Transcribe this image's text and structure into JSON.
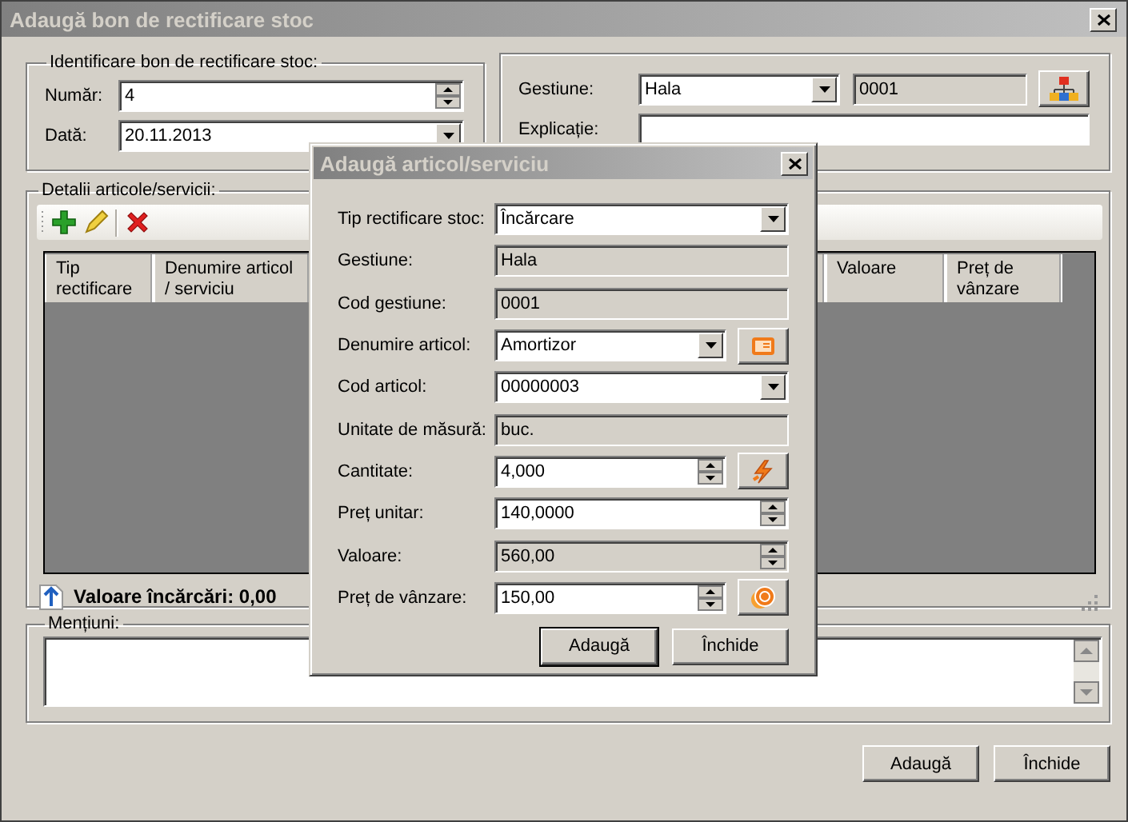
{
  "window": {
    "title": "Adaugă bon de rectificare stoc"
  },
  "identification": {
    "legend": "Identificare bon de rectificare stoc:",
    "fields": [
      {
        "label": "Număr:",
        "value": "4",
        "kind": "spin"
      },
      {
        "label": "Dată:",
        "value": "20.11.2013",
        "kind": "dropdown"
      }
    ]
  },
  "location": {
    "fields": [
      {
        "label": "Gestiune:",
        "value": "Hala",
        "kind": "dropdown",
        "code": "0001",
        "button": true
      },
      {
        "label": "Explicație:",
        "kind": "text",
        "button": false
      }
    ]
  },
  "details": {
    "legend": "Detalii articole/servicii:",
    "columns": [
      "Tip rectificare",
      "Denumire articol / serviciu",
      "Valoare",
      "Preț de vânzare"
    ],
    "total_label": "Valoare încărcări:",
    "total_value": "0,00"
  },
  "notes": {
    "legend": "Mențiuni:"
  },
  "buttons": [
    {
      "label": "Adaugă",
      "default": false
    },
    {
      "label": "Închide",
      "default": false
    }
  ],
  "dialog": {
    "title": "Adaugă articol/serviciu",
    "fields": [
      {
        "label": "Tip rectificare stoc:",
        "value": "Încărcare",
        "kind": "dropdown",
        "button": false
      },
      {
        "label": "Gestiune:",
        "value": "Hala",
        "kind": "readonly",
        "button": false
      },
      {
        "label": "Cod gestiune:",
        "value": "0001",
        "kind": "readonly",
        "button": false
      },
      {
        "label": "Denumire articol:",
        "value": "Amortizor",
        "kind": "dropdown",
        "button": true
      },
      {
        "label": "Cod articol:",
        "value": "00000003",
        "kind": "dropdown",
        "button": false
      },
      {
        "label": "Unitate de măsură:",
        "value": "buc.",
        "kind": "readonly",
        "button": false
      },
      {
        "label": "Cantitate:",
        "value": "4,000",
        "kind": "spin",
        "button": true
      },
      {
        "label": "Preț unitar:",
        "value": "140,0000",
        "kind": "spin",
        "button": false
      },
      {
        "label": "Valoare:",
        "value": "560,00",
        "kind": "readonly_spin",
        "button": false
      },
      {
        "label": "Preț de vânzare:",
        "value": "150,00",
        "kind": "spin",
        "button": true
      }
    ],
    "buttons": [
      {
        "label": "Adaugă",
        "default": true
      },
      {
        "label": "Închide",
        "default": false
      }
    ]
  }
}
